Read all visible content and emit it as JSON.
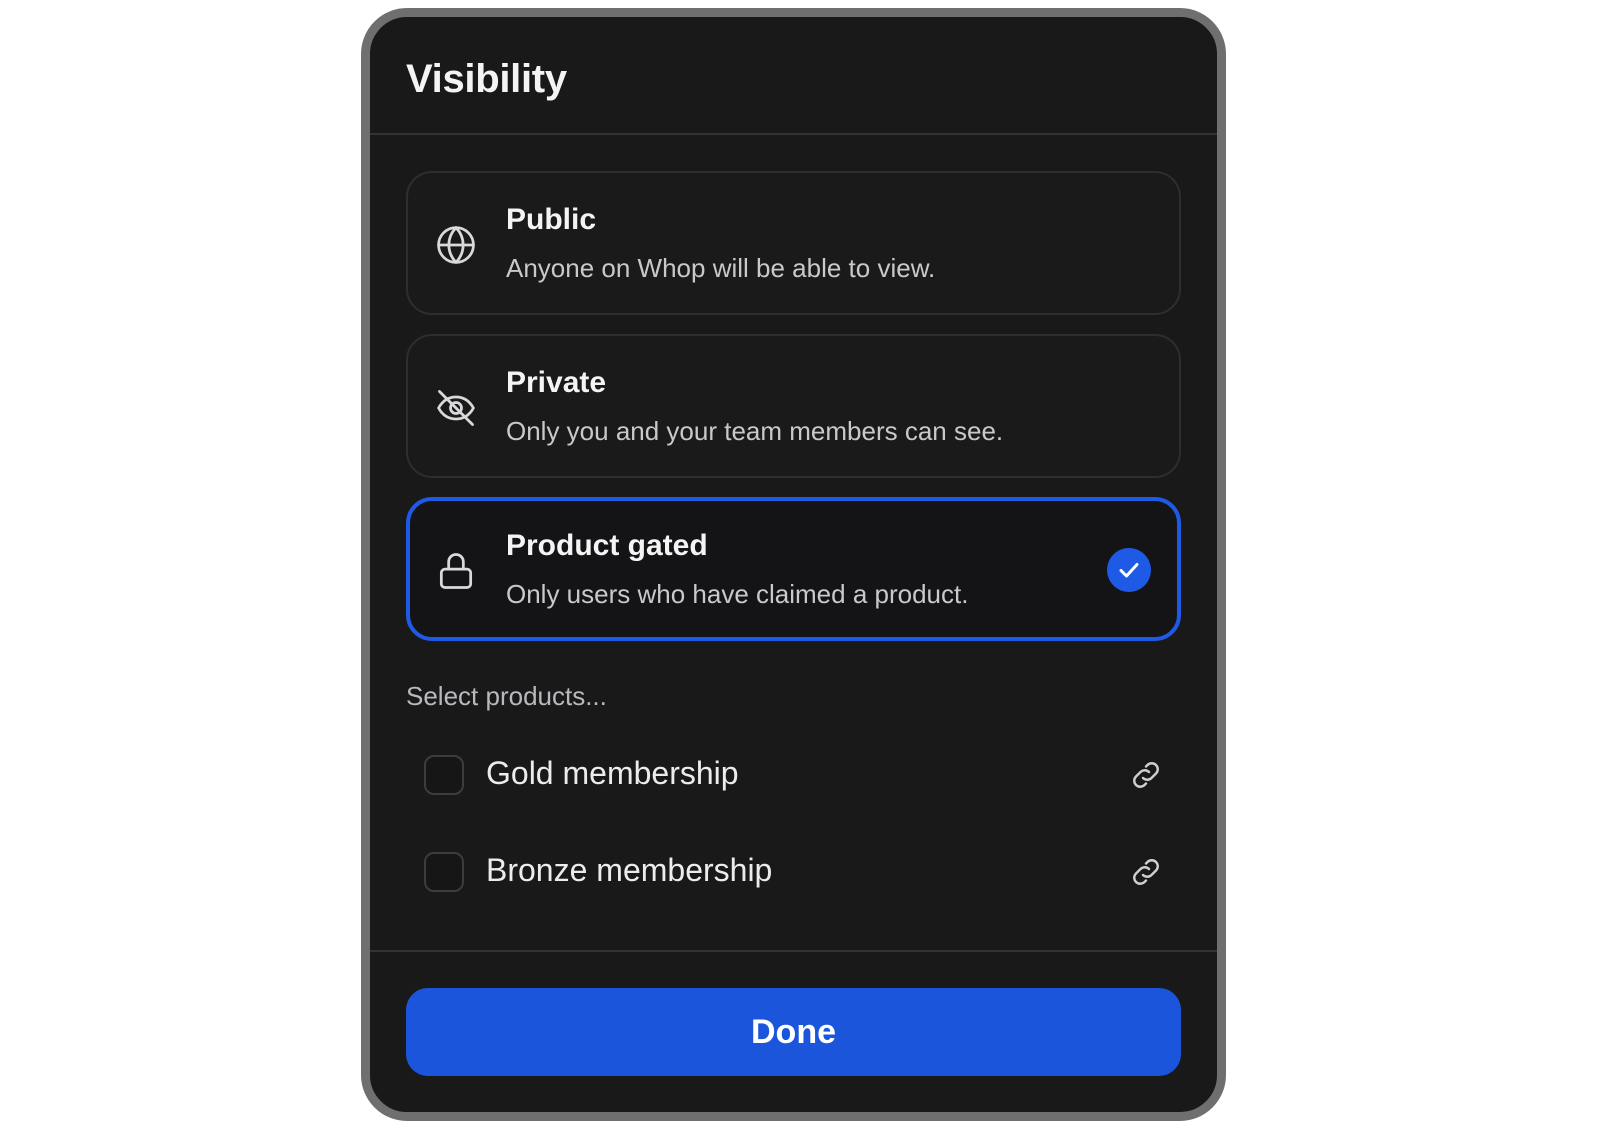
{
  "modal": {
    "title": "Visibility"
  },
  "options": [
    {
      "title": "Public",
      "description": "Anyone on Whop will be able to view.",
      "icon": "globe-icon",
      "selected": false
    },
    {
      "title": "Private",
      "description": "Only you and your team members can see.",
      "icon": "eye-off-icon",
      "selected": false
    },
    {
      "title": "Product gated",
      "description": "Only users who have claimed a product.",
      "icon": "lock-icon",
      "selected": true
    }
  ],
  "products": {
    "label": "Select products...",
    "items": [
      {
        "name": "Gold membership",
        "checked": false,
        "icon": "link-icon"
      },
      {
        "name": "Bronze membership",
        "checked": false,
        "icon": "link-icon"
      }
    ]
  },
  "footer": {
    "done_label": "Done"
  },
  "colors": {
    "background": "#19191a",
    "accent": "#1f5ae6",
    "frame": "#6f6f70"
  }
}
